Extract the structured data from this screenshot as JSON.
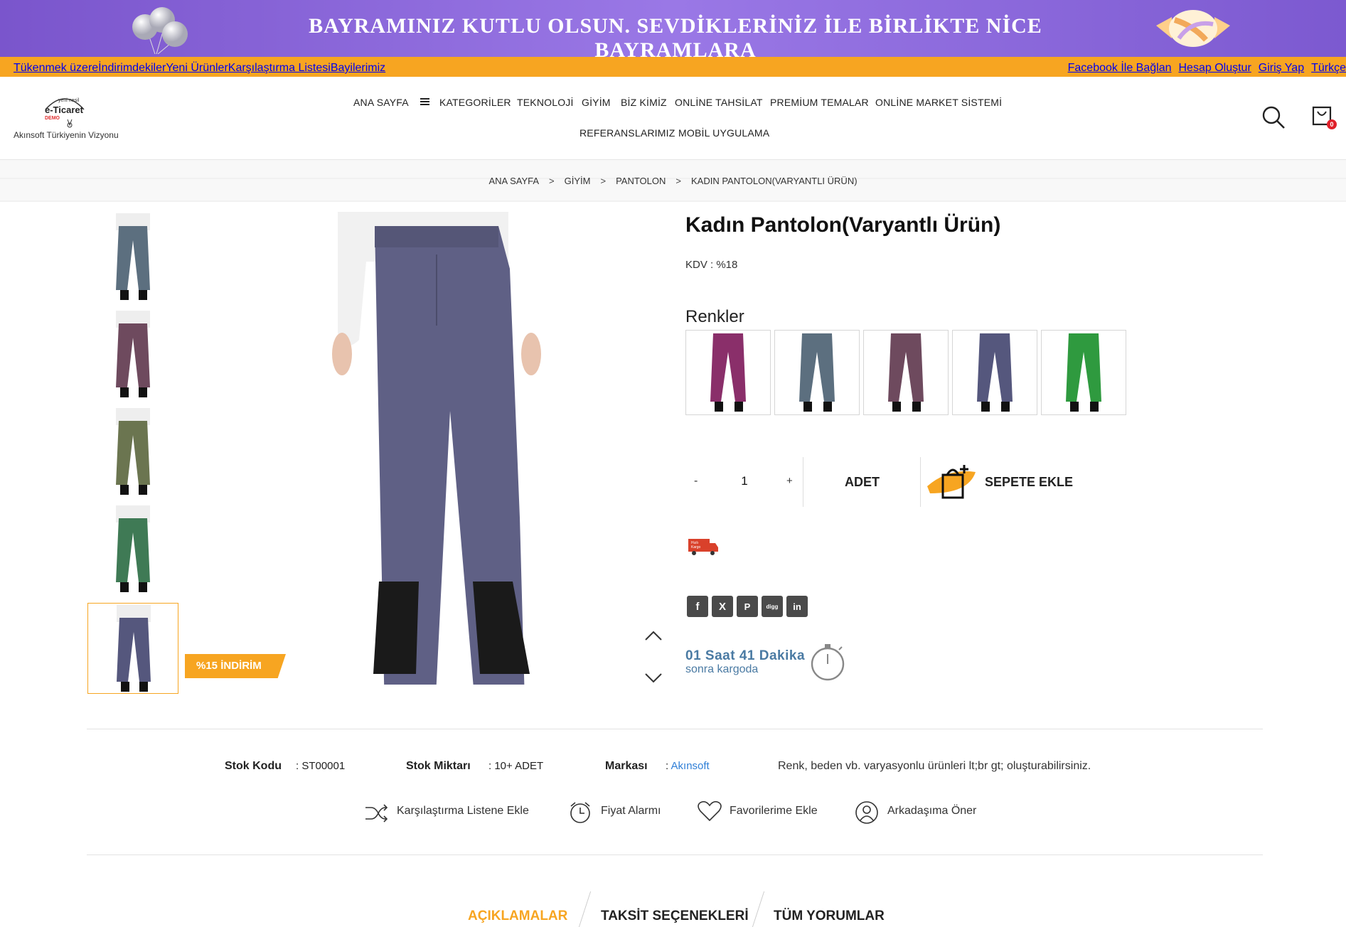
{
  "banner": {
    "text": "BAYRAMINIZ KUTLU OLSUN. SEVDİKLERİNİZ İLE BİRLİKTE NİCE BAYRAMLARA"
  },
  "topbar": {
    "left_links": [
      "Tükenmek üzere",
      "İndirimdekiler",
      "Yeni Ürünler",
      "Karşılaştırma Listesi",
      "Bayilerimiz"
    ],
    "right_links": [
      "Facebook İle Bağlan",
      "Hesap Oluştur",
      "Giriş Yap",
      "Türkçe"
    ]
  },
  "header": {
    "logo_top": "yeni nesil",
    "logo_main": "e-Ticaret",
    "logo_demo": "DEMO",
    "logo_tagline": "Akınsoft Türkiyenin Vizyonu",
    "cart_count": "0",
    "nav": [
      "ANA SAYFA",
      "KATEGORİLER",
      "TEKNOLOJİ",
      "GİYİM",
      "BİZ KİMİZ",
      "ONLİNE TAHSİLAT",
      "PREMİUM TEMALAR",
      "ONLİNE MARKET SİSTEMİ",
      "REFERANSLARIMIZ",
      "MOBİL UYGULAMA"
    ]
  },
  "breadcrumb": [
    "ANA SAYFA",
    "GİYİM",
    "PANTOLON",
    "KADIN PANTOLON(VARYANTLI ÜRÜN)"
  ],
  "gallery": {
    "thumbnails": [
      {
        "color_name": "blue-grey",
        "color": "#5c6f7f"
      },
      {
        "color_name": "plum",
        "color": "#6e4a5e"
      },
      {
        "color_name": "olive",
        "color": "#6b7550"
      },
      {
        "color_name": "green",
        "color": "#3f7a55"
      },
      {
        "color_name": "indigo",
        "color": "#55577d"
      }
    ],
    "active_index": 4,
    "discount_badge": "%15 İNDİRİM",
    "main_color": "#5f6085"
  },
  "product": {
    "title": "Kadın Pantolon(Varyantlı Ürün)",
    "kdv": "KDV : %18",
    "colors_label": "Renkler",
    "swatches": [
      {
        "color_name": "magenta",
        "color": "#8a2f6a"
      },
      {
        "color_name": "blue-grey",
        "color": "#5c6f7f"
      },
      {
        "color_name": "plum",
        "color": "#6e4a5e"
      },
      {
        "color_name": "indigo",
        "color": "#55577d"
      },
      {
        "color_name": "green",
        "color": "#2f9a3f"
      }
    ],
    "qty_minus": "-",
    "qty_value": "1",
    "qty_plus": "+",
    "unit": "ADET",
    "add_to_cart": "SEPETE EKLE",
    "cargo_badge": "Hızlı Kargo",
    "social": [
      "f",
      "X",
      "P",
      "digg",
      "in"
    ],
    "timer_line1": "01 Saat 41 Dakika",
    "timer_line2": "sonra kargoda"
  },
  "details": {
    "stock_code_label": "Stok Kodu",
    "stock_code": ": ST00001",
    "stock_qty_label": "Stok Miktarı",
    "stock_qty": ": 10+ ADET",
    "brand_label": "Markası",
    "brand_prefix": ":",
    "brand": "Akınsoft",
    "variant_note": "Renk, beden vb. varyasyonlu ürünleri lt;br gt; oluşturabilirsiniz."
  },
  "actions": [
    "Karşılaştırma Listene Ekle",
    "Fiyat Alarmı",
    "Favorilerime Ekle",
    "Arkadaşıma Öner"
  ],
  "tabs": [
    "AÇIKLAMALAR",
    "TAKSİT SEÇENEKLERİ",
    "TÜM YORUMLAR"
  ],
  "colors": {
    "accent": "#f7a521",
    "banner": "#8a66dc",
    "link": "#2f7fd7",
    "timer": "#4a7aa3"
  }
}
